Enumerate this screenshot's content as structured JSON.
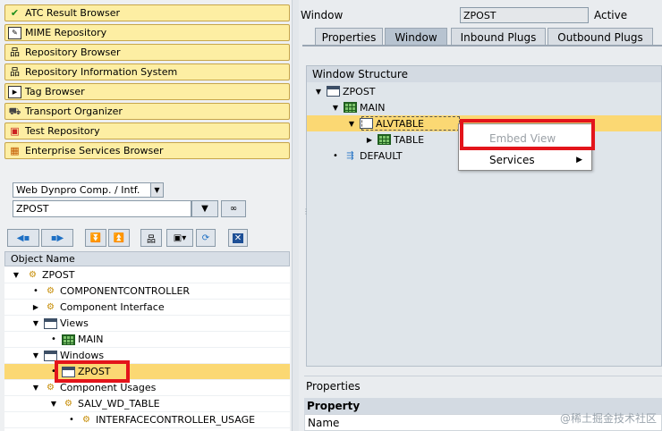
{
  "nav_buttons": [
    {
      "label": "ATC Result Browser",
      "icon": "checklist-icon"
    },
    {
      "label": "MIME Repository",
      "icon": "mime-icon"
    },
    {
      "label": "Repository Browser",
      "icon": "hierarchy-icon"
    },
    {
      "label": "Repository Information System",
      "icon": "hierarchy-icon"
    },
    {
      "label": "Tag Browser",
      "icon": "tag-icon"
    },
    {
      "label": "Transport Organizer",
      "icon": "truck-icon"
    },
    {
      "label": "Test Repository",
      "icon": "test-icon"
    },
    {
      "label": "Enterprise Services Browser",
      "icon": "services-icon"
    }
  ],
  "object_type": {
    "selected": "Web Dynpro Comp. / Intf."
  },
  "object_name_input": {
    "value": "ZPOST"
  },
  "tree": {
    "header": "Object Name",
    "nodes": [
      {
        "label": "ZPOST"
      },
      {
        "label": "COMPONENTCONTROLLER"
      },
      {
        "label": "Component Interface"
      },
      {
        "label": "Views"
      },
      {
        "label": "MAIN"
      },
      {
        "label": "Windows"
      },
      {
        "label": "ZPOST"
      },
      {
        "label": "Component Usages"
      },
      {
        "label": "SALV_WD_TABLE"
      },
      {
        "label": "INTERFACECONTROLLER_USAGE"
      }
    ]
  },
  "window_header": {
    "label": "Window",
    "value": "ZPOST",
    "status": "Active"
  },
  "tabs": [
    {
      "label": "Properties"
    },
    {
      "label": "Window"
    },
    {
      "label": "Inbound Plugs"
    },
    {
      "label": "Outbound Plugs"
    }
  ],
  "window_structure": {
    "header": "Window Structure",
    "nodes": [
      {
        "label": "ZPOST"
      },
      {
        "label": "MAIN"
      },
      {
        "label": "ALVTABLE"
      },
      {
        "label": "TABLE"
      },
      {
        "label": "DEFAULT"
      }
    ]
  },
  "context_menu": {
    "items": [
      {
        "label": "Embed View",
        "disabled": true
      },
      {
        "label": "Services"
      }
    ]
  },
  "properties": {
    "title": "Properties",
    "column_header": "Property",
    "first_row": "Name"
  },
  "watermark": "@稀土掘金技术社区",
  "colors": {
    "highlight": "#e3141b",
    "nav_button": "#fdeea3",
    "selected_row": "#fbd873"
  }
}
